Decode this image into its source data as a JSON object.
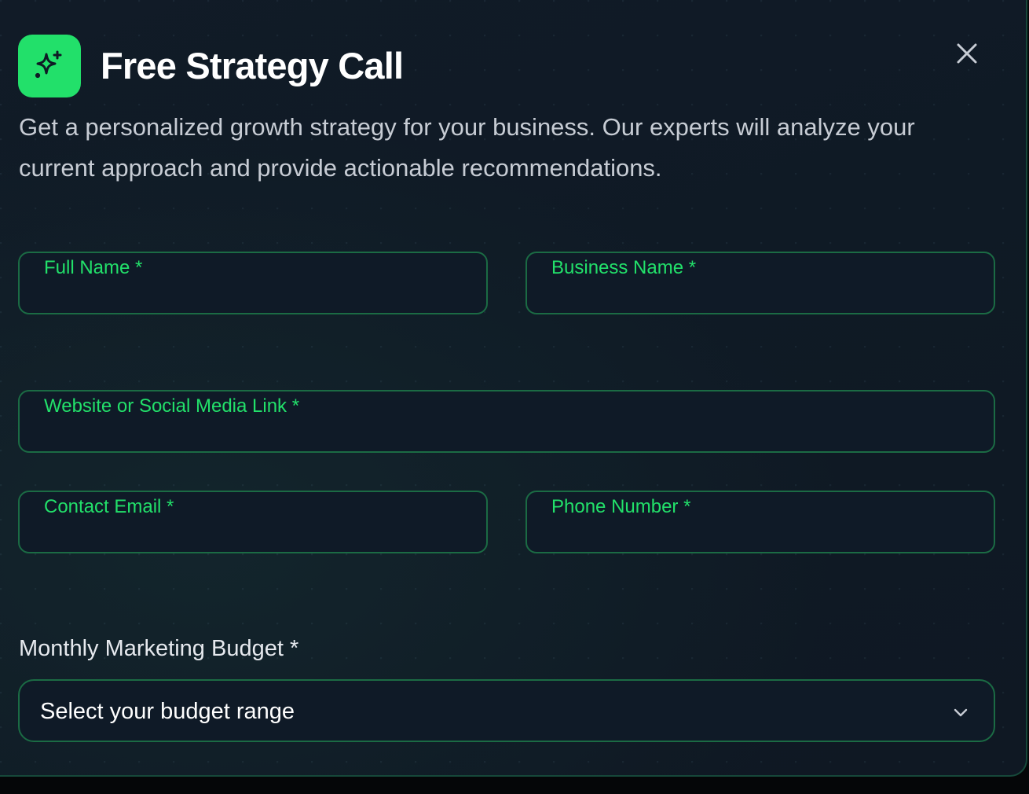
{
  "dialog": {
    "title": "Free Strategy Call",
    "description": "Get a personalized growth strategy for your business. Our experts will analyze your current approach and provide actionable recommendations.",
    "icon": "sparkles-icon",
    "close_icon": "close-icon"
  },
  "form": {
    "full_name": {
      "label": "Full Name *",
      "value": ""
    },
    "business_name": {
      "label": "Business Name *",
      "value": ""
    },
    "website": {
      "label": "Website or Social Media Link *",
      "value": ""
    },
    "email": {
      "label": "Contact Email *",
      "value": ""
    },
    "phone": {
      "label": "Phone Number *",
      "value": ""
    },
    "budget": {
      "label": "Monthly Marketing Budget *",
      "selected": "Select your budget range",
      "icon": "chevron-down-icon"
    }
  },
  "colors": {
    "accent": "#22e06a",
    "border": "#1b6b44",
    "background": "#111b27"
  }
}
